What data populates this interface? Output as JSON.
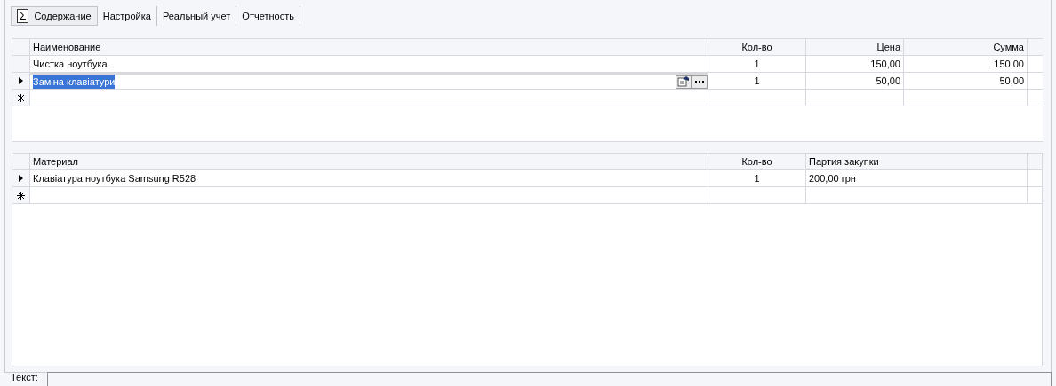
{
  "tabs": [
    {
      "symbol": "Σ",
      "label": "Содержание",
      "selected": true
    },
    {
      "label": "Настройка",
      "selected": false
    },
    {
      "label": "Реальный учет",
      "selected": false
    },
    {
      "label": "Отчетность",
      "selected": false
    }
  ],
  "services": {
    "columns": [
      {
        "label": "Наименование"
      },
      {
        "label": "Кол-во"
      },
      {
        "label": "Цена"
      },
      {
        "label": "Сумма"
      }
    ],
    "rows": [
      {
        "kind": "normal",
        "editing": false,
        "cells": [
          "Чистка ноутбука",
          "1",
          "150,00",
          "150,00"
        ]
      },
      {
        "kind": "current",
        "editing": true,
        "cells": [
          "Заміна клавіатури",
          "1",
          "50,00",
          "50,00"
        ]
      },
      {
        "kind": "new",
        "editing": false,
        "cells": [
          "",
          "",
          "",
          ""
        ]
      }
    ]
  },
  "materials": {
    "columns": [
      {
        "label": "Материал"
      },
      {
        "label": "Кол-во"
      },
      {
        "label": "Партия закупки"
      }
    ],
    "rows": [
      {
        "kind": "current",
        "cells": [
          "Клавіатура ноутбука Samsung R528",
          "1",
          "200,00 грн"
        ]
      },
      {
        "kind": "new",
        "cells": [
          "",
          "",
          ""
        ]
      }
    ]
  },
  "text_field": {
    "label": "Текст:"
  }
}
